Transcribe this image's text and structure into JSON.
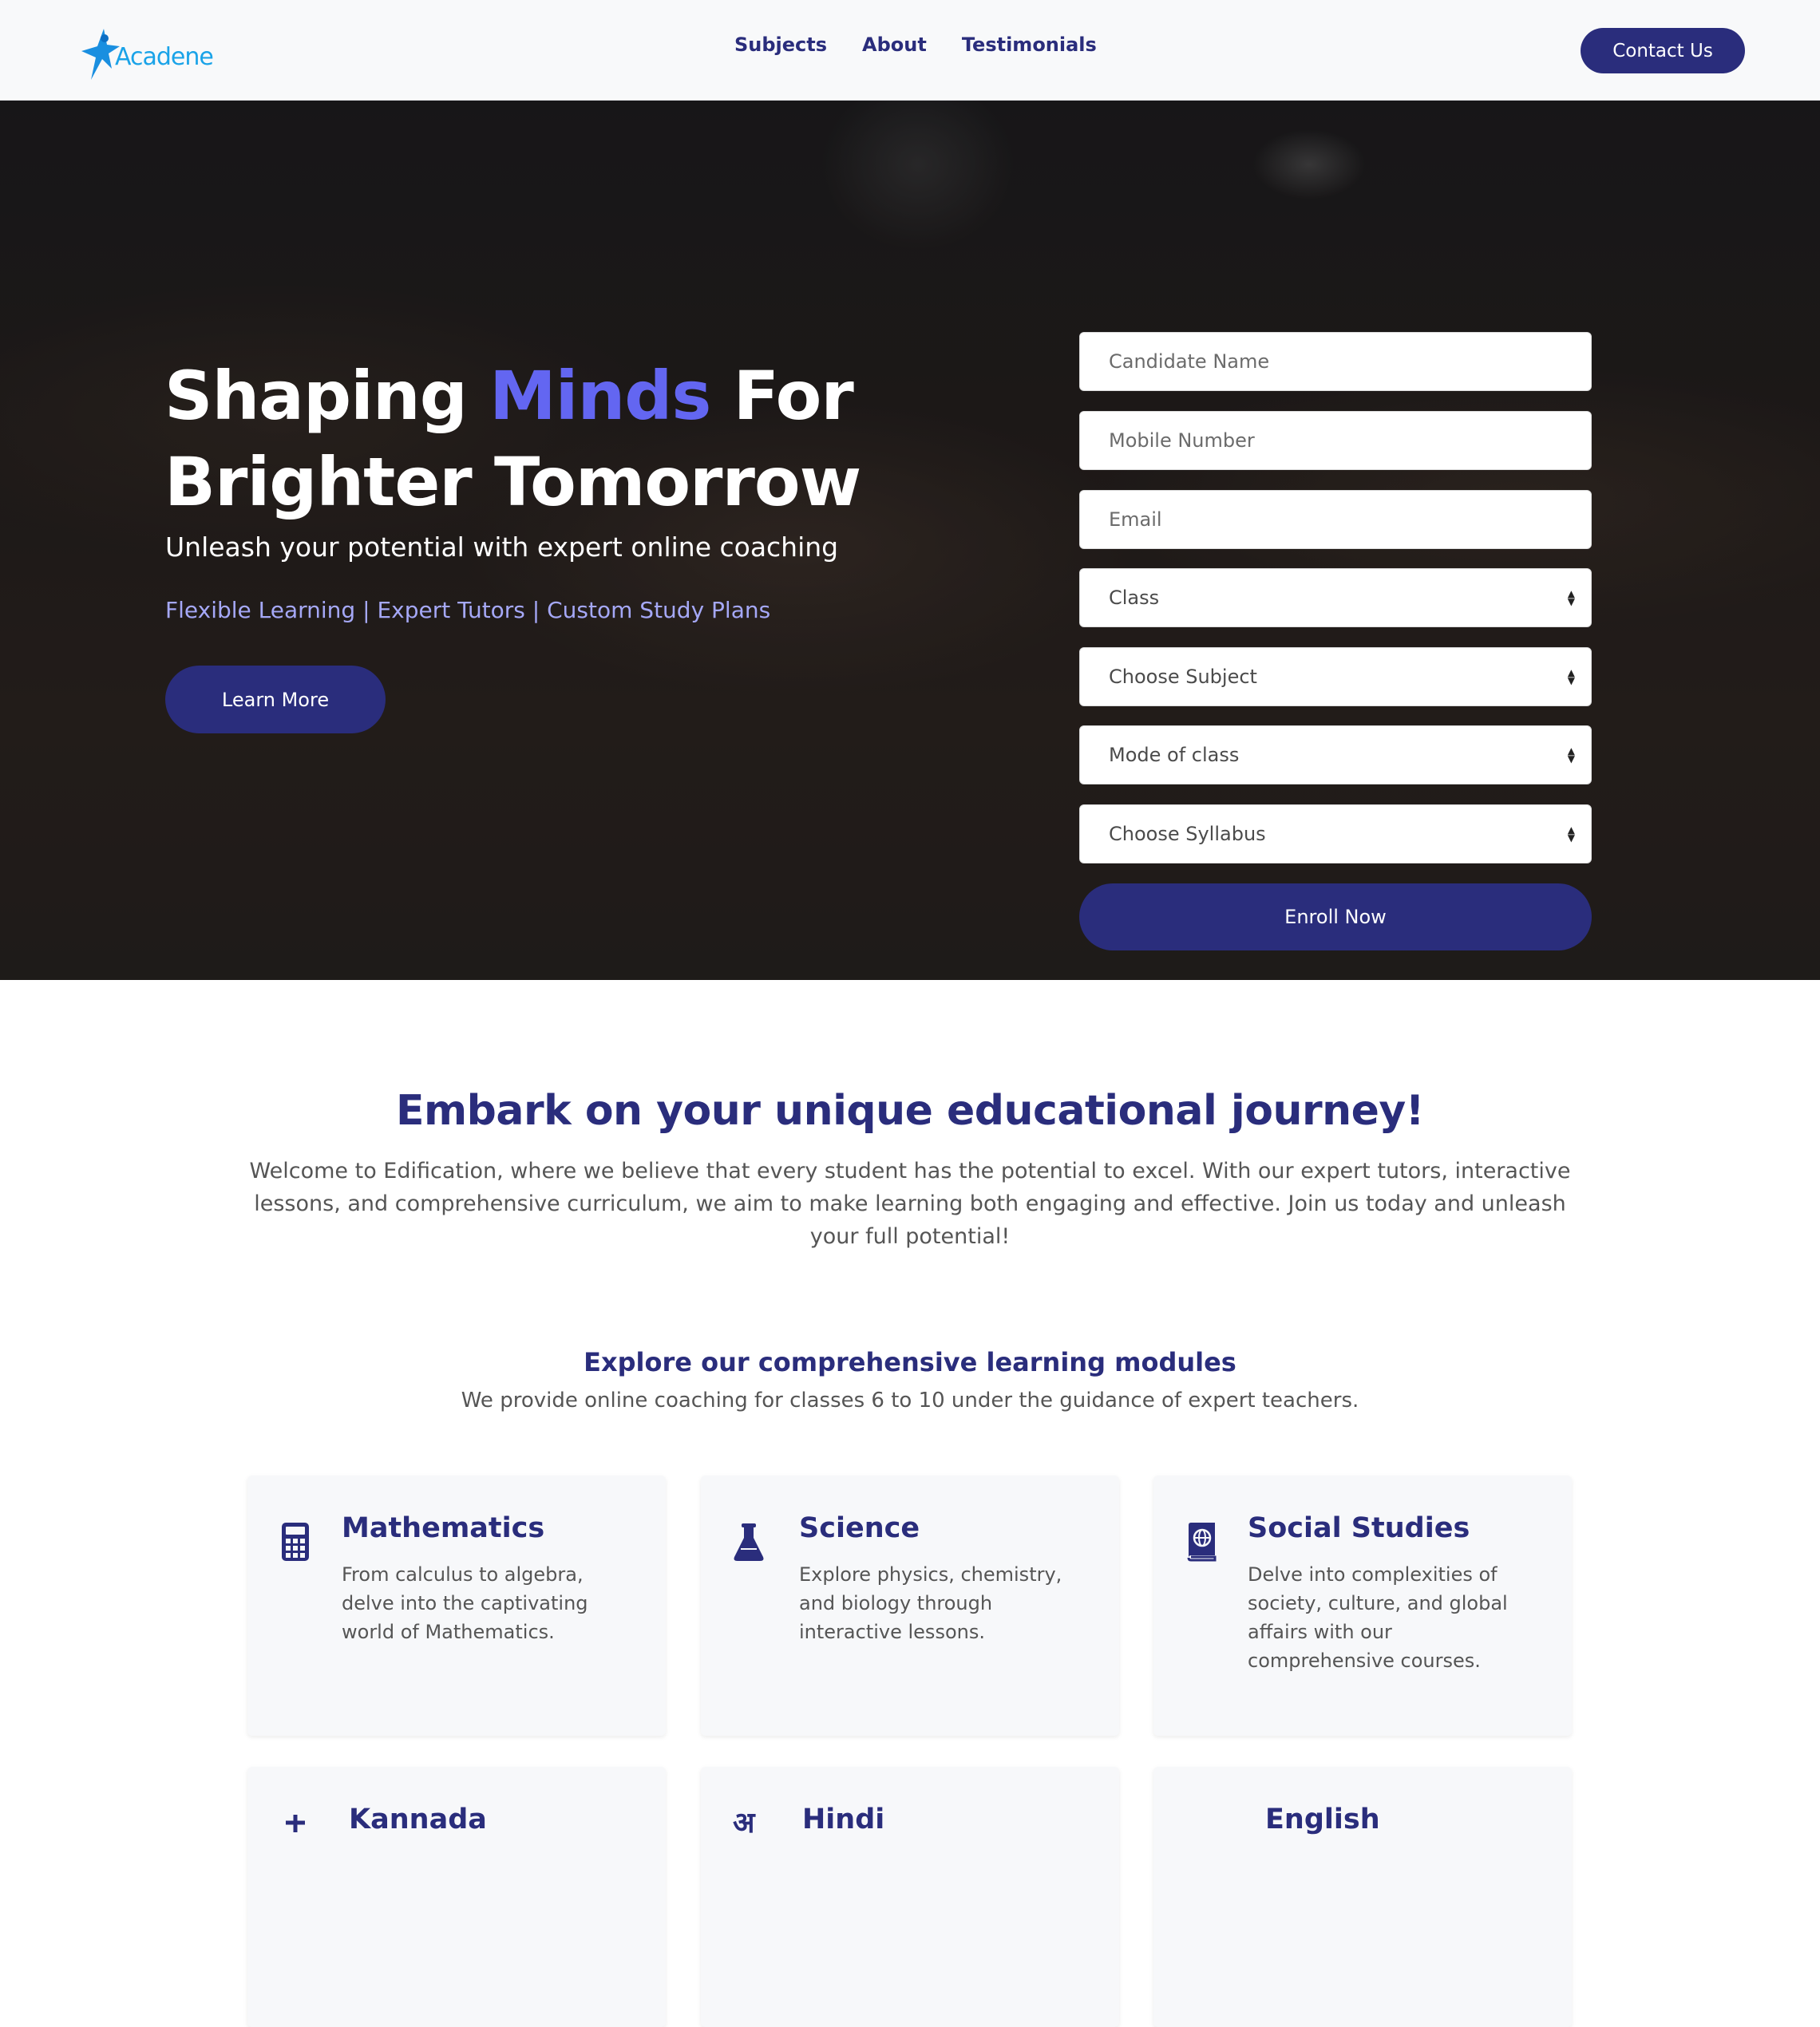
{
  "brand": {
    "name": "Acadene",
    "logo_color": "#1aa3e8"
  },
  "nav": {
    "links": [
      "Subjects",
      "About",
      "Testimonials"
    ],
    "contact_label": "Contact Us"
  },
  "colors": {
    "primary": "#2a2d7c",
    "accent": "#6366f1",
    "tags": "#a5a8f7"
  },
  "hero": {
    "title_part1": "Shaping ",
    "title_accent": "Minds",
    "title_part2": " For Brighter Tomorrow",
    "subtitle": "Unleash your potential with expert online coaching",
    "tags": "Flexible Learning | Expert Tutors | Custom Study Plans",
    "learn_more_label": "Learn More"
  },
  "form": {
    "candidate_name_placeholder": "Candidate Name",
    "mobile_placeholder": "Mobile Number",
    "email_placeholder": "Email",
    "class_label": "Class",
    "subject_label": "Choose Subject",
    "mode_label": "Mode of class",
    "syllabus_label": "Choose Syllabus",
    "enroll_label": "Enroll Now"
  },
  "intro": {
    "title": "Embark on your unique educational journey!",
    "text": "Welcome to Edification, where we believe that every student has the potential to excel. With our expert tutors, interactive lessons, and comprehensive curriculum, we aim to make learning both engaging and effective. Join us today and unleash your full potential!"
  },
  "modules": {
    "title": "Explore our comprehensive learning modules",
    "subtitle": "We provide online coaching for classes 6 to 10 under the guidance of expert teachers.",
    "cards": [
      {
        "icon": "calculator-icon",
        "title": "Mathematics",
        "desc": "From calculus to algebra, delve into the captivating world of Mathematics."
      },
      {
        "icon": "flask-icon",
        "title": "Science",
        "desc": "Explore physics, chemistry, and biology through interactive lessons."
      },
      {
        "icon": "globe-book-icon",
        "title": "Social Studies",
        "desc": "Delve into complexities of society, culture, and global affairs with our comprehensive courses."
      },
      {
        "icon": "kannada-letter-icon",
        "title": "Kannada",
        "desc": ""
      },
      {
        "icon": "hindi-letter-icon",
        "title": "Hindi",
        "desc": ""
      },
      {
        "icon": "english-icon",
        "title": "English",
        "desc": ""
      }
    ]
  }
}
